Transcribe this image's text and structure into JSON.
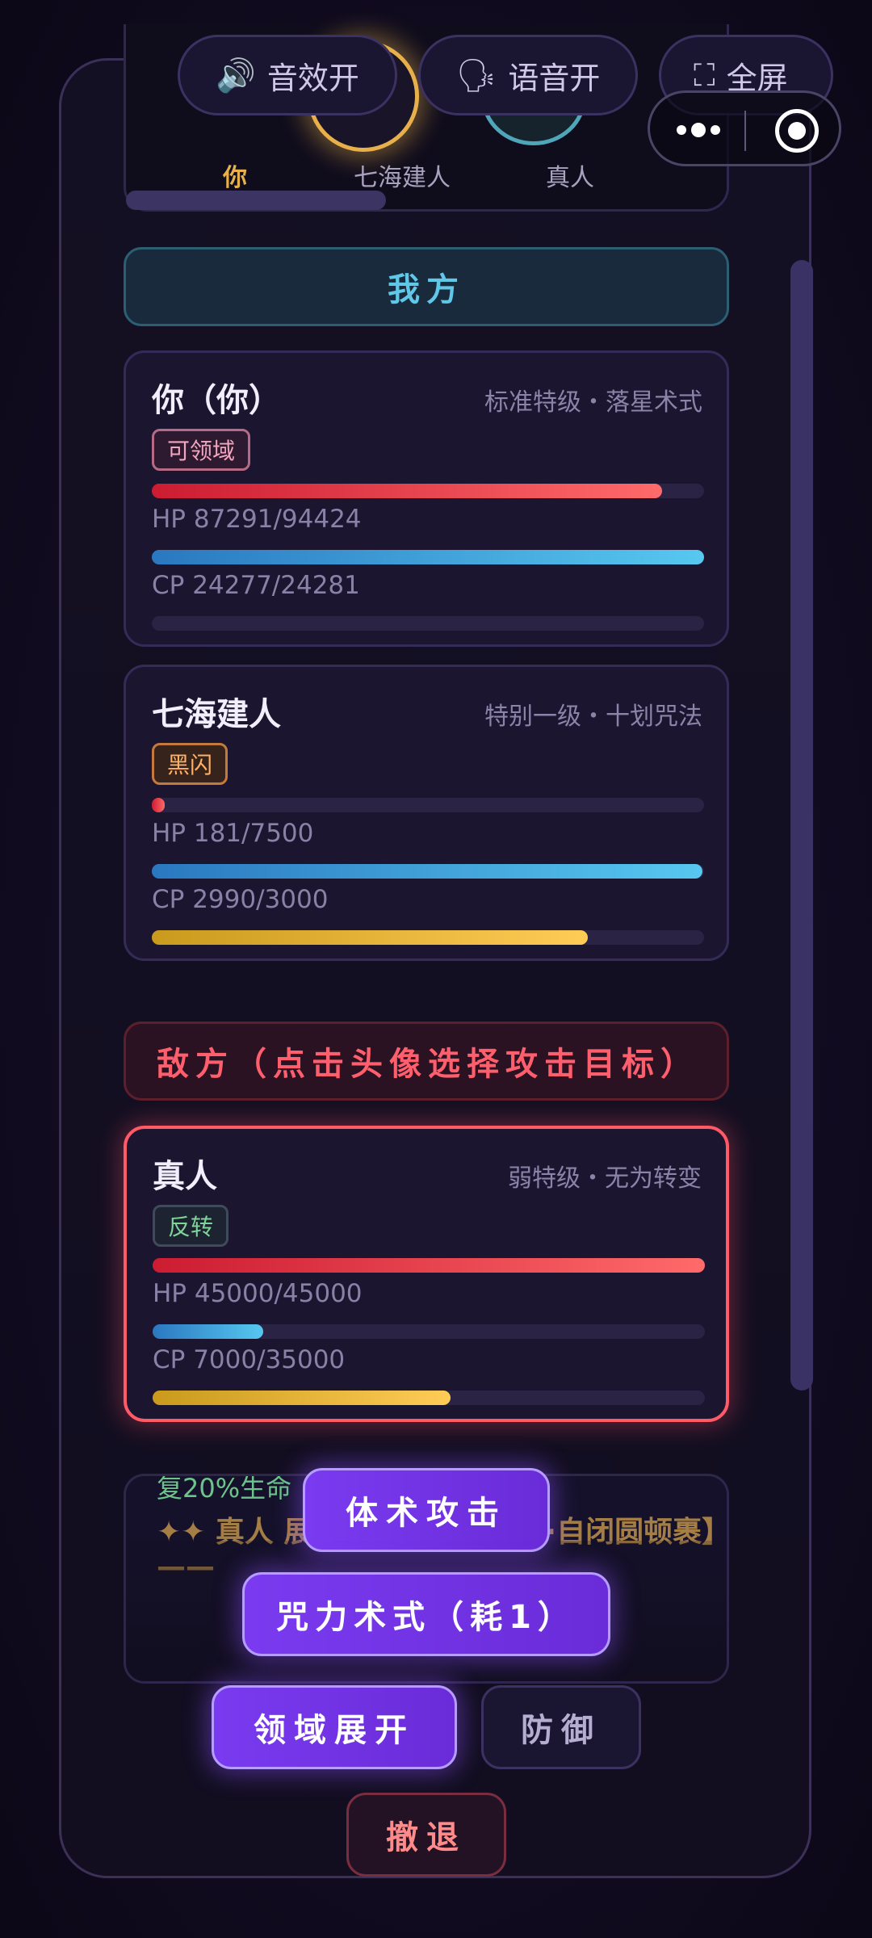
{
  "topbar": {
    "sound_label": "音效开",
    "voice_label": "语音开",
    "fullscreen_label": "全屏"
  },
  "avatars": {
    "you_label": "你",
    "ally_label": "七海建人",
    "enemy_label": "真人"
  },
  "sections": {
    "ally_title": "我方",
    "enemy_title": "敌方（点击头像选择攻击目标）"
  },
  "allies": [
    {
      "name": "你（你）",
      "rank": "标准特级・落星术式",
      "tag": "可领域",
      "hp_text": "HP 87291/94424",
      "hp_ratio": 0.924,
      "cp_text": "CP 24277/24281",
      "cp_ratio": 1.0,
      "extra_ratio": 0
    },
    {
      "name": "七海建人",
      "rank": "特别一级・十划咒法",
      "tag": "黑闪",
      "hp_text": "HP 181/7500",
      "hp_ratio": 0.024,
      "cp_text": "CP 2990/3000",
      "cp_ratio": 0.997,
      "extra_ratio": 0.79
    }
  ],
  "enemies": [
    {
      "name": "真人",
      "rank": "弱特级・无为转变",
      "tag": "反转",
      "hp_text": "HP 45000/45000",
      "hp_ratio": 1.0,
      "cp_text": "CP 7000/35000",
      "cp_ratio": 0.2,
      "extra_ratio": 0.54
    }
  ],
  "log": {
    "line1": "复20%生命",
    "line2": "✦✦ 真人 展开领域【无为转变·自闭圆顿裹】——"
  },
  "actions": {
    "attack": "体术攻击",
    "spell": "咒力术式（耗1）",
    "domain": "领域展开",
    "defend": "防御",
    "retreat": "撤退"
  },
  "colors": {
    "accent_purple": "#7a3bf0",
    "ally_cyan": "#5fc7e8",
    "enemy_red": "#ff5a66",
    "hp_red": "#e8333f",
    "cp_blue": "#3aa0dd",
    "gold": "#e5b33a"
  }
}
